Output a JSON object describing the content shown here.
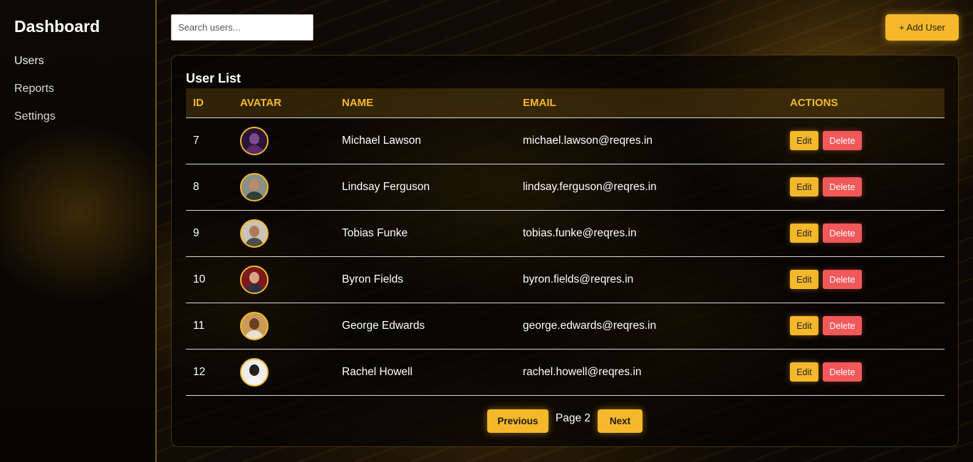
{
  "sidebar": {
    "title": "Dashboard",
    "items": [
      {
        "label": "Users"
      },
      {
        "label": "Reports"
      },
      {
        "label": "Settings"
      }
    ]
  },
  "topbar": {
    "search_placeholder": "Search users...",
    "add_user_label": "+ Add User"
  },
  "panel": {
    "title": "User List",
    "columns": [
      "ID",
      "AVATAR",
      "NAME",
      "EMAIL",
      "ACTIONS"
    ],
    "rows": [
      {
        "id": "7",
        "name": "Michael Lawson",
        "email": "michael.lawson@reqres.in",
        "avatar_colors": {
          "bg": "#2b1438",
          "head": "#7a4a8c",
          "body": "#5a2a6a"
        }
      },
      {
        "id": "8",
        "name": "Lindsay Ferguson",
        "email": "lindsay.ferguson@reqres.in",
        "avatar_colors": {
          "bg": "#8a8f86",
          "head": "#b98b6a",
          "body": "#2f3f3a"
        }
      },
      {
        "id": "9",
        "name": "Tobias Funke",
        "email": "tobias.funke@reqres.in",
        "avatar_colors": {
          "bg": "#c9c3b6",
          "head": "#b07a5a",
          "body": "#4a4f4a"
        }
      },
      {
        "id": "10",
        "name": "Byron Fields",
        "email": "byron.fields@reqres.in",
        "avatar_colors": {
          "bg": "#7a1a1a",
          "head": "#d8a582",
          "body": "#2a3148"
        }
      },
      {
        "id": "11",
        "name": "George Edwards",
        "email": "george.edwards@reqres.in",
        "avatar_colors": {
          "bg": "#c99a5a",
          "head": "#6a3f25",
          "body": "#e8e0d0"
        }
      },
      {
        "id": "12",
        "name": "Rachel Howell",
        "email": "rachel.howell@reqres.in",
        "avatar_colors": {
          "bg": "#ececec",
          "head": "#2a1f1a",
          "body": "#f5f5f5"
        }
      }
    ],
    "edit_label": "Edit",
    "delete_label": "Delete"
  },
  "pagination": {
    "previous_label": "Previous",
    "page_label": "Page 2",
    "next_label": "Next"
  },
  "colors": {
    "accent": "#f5b82a",
    "danger": "#f0585a"
  }
}
